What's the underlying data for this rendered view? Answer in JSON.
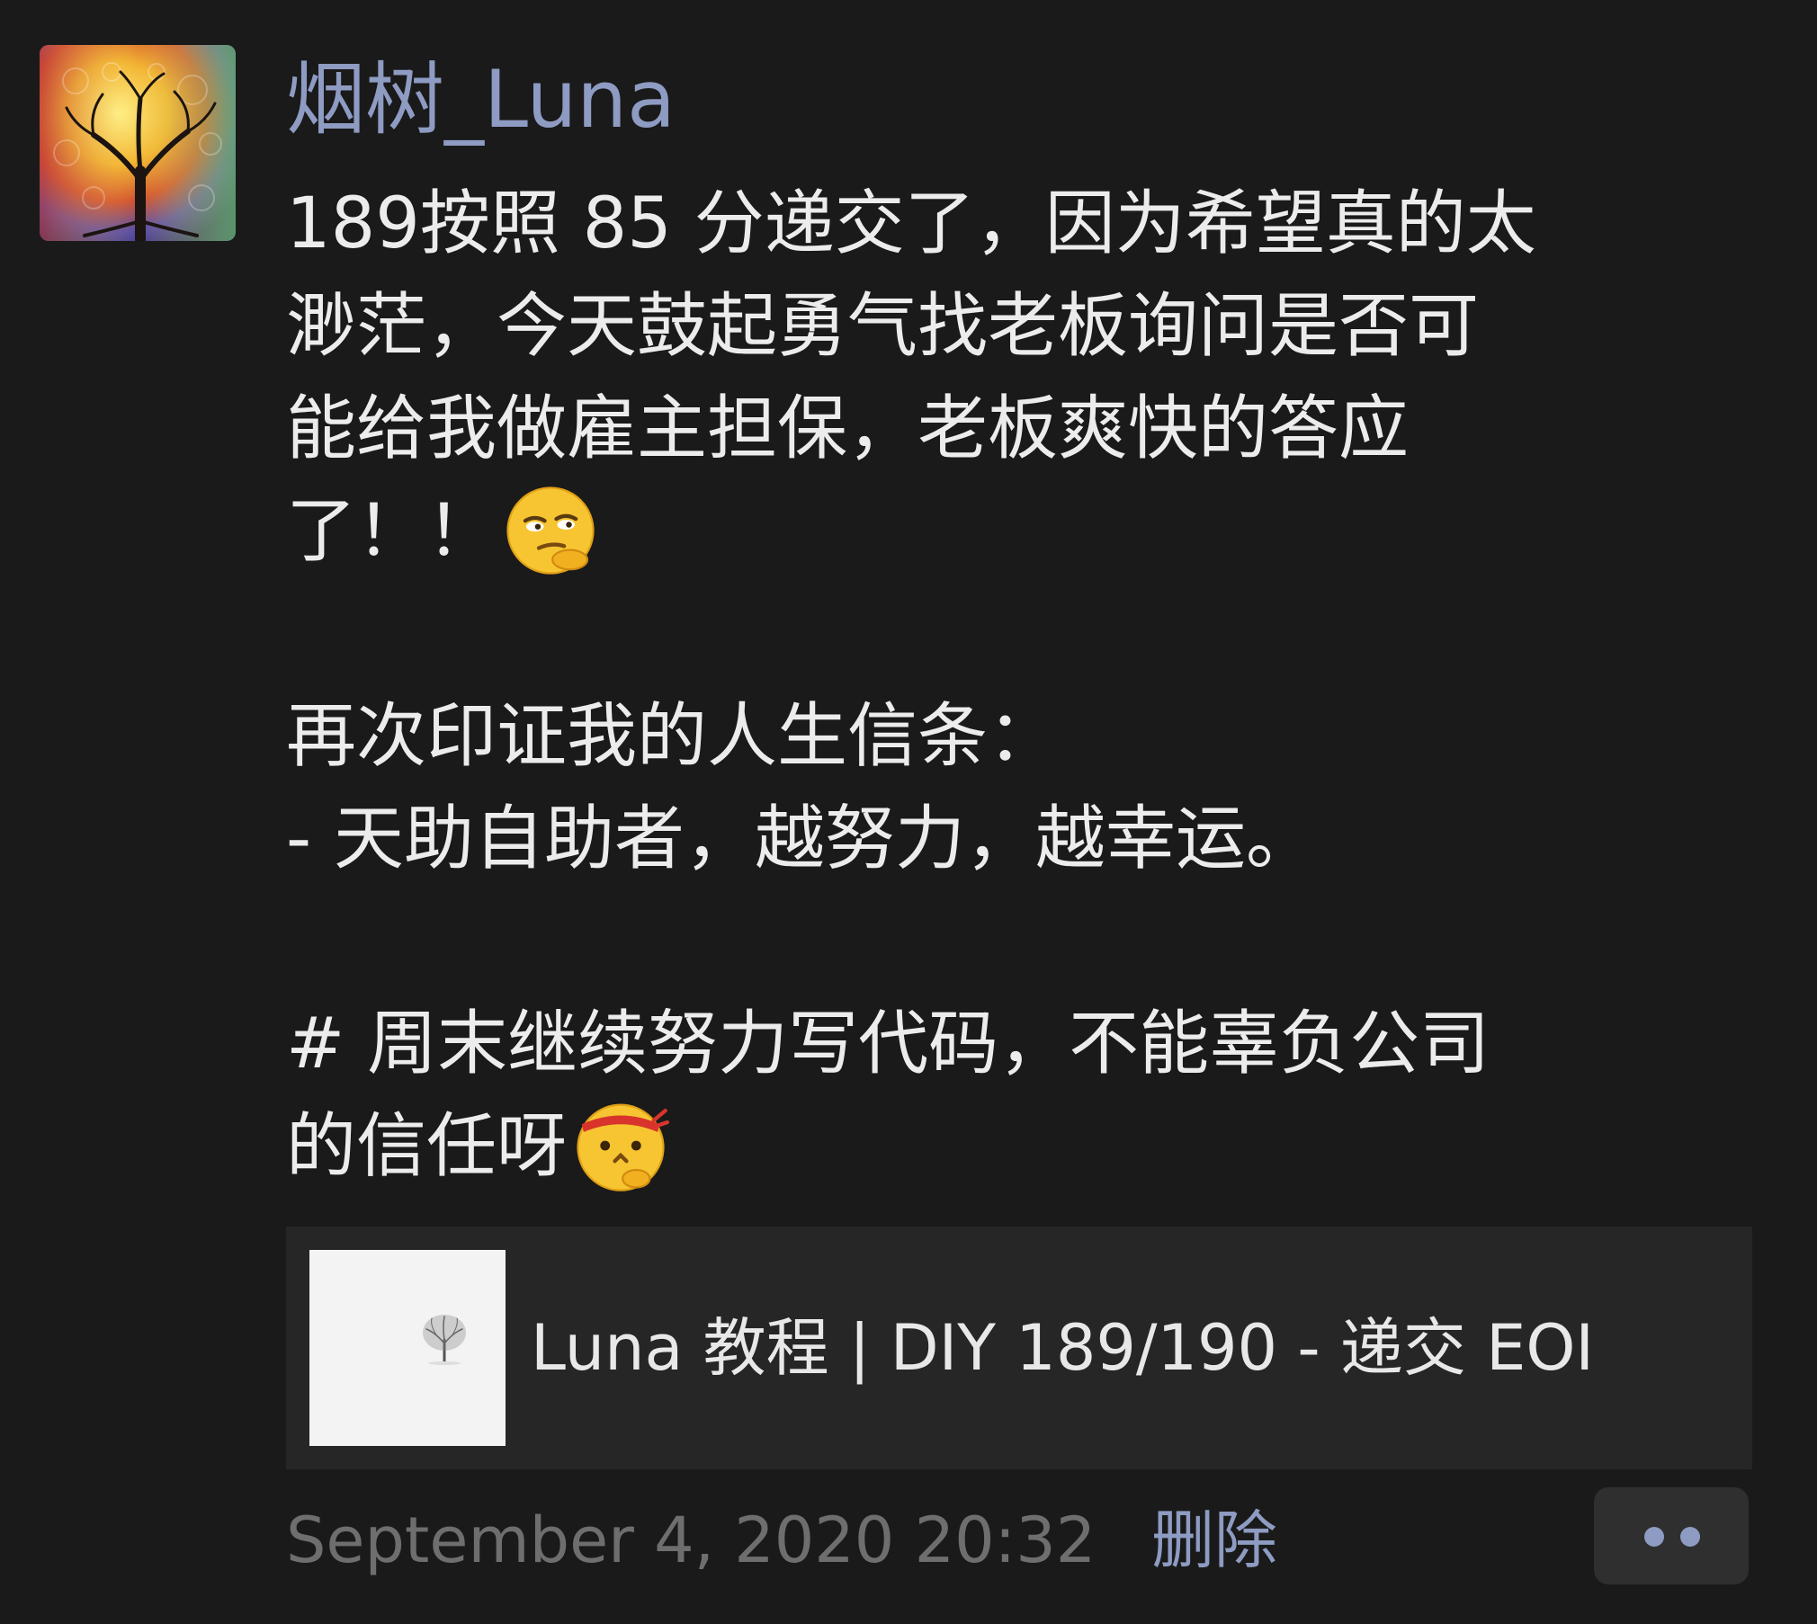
{
  "post": {
    "username": "烟树_Luna",
    "text_lines": [
      "189按照 85 分递交了，因为希望真的太",
      "渺茫，今天鼓起勇气找老板询问是否可",
      "能给我做雇主担保，老板爽快的答应",
      "了！！",
      "",
      "再次印证我的人生信条：",
      "- 天助自助者，越努力，越幸运。",
      "",
      "# 周末继续努力写代码，不能辜负公司",
      "的信任呀"
    ],
    "emojis": [
      "smirk-pointing-emoji",
      "determined-headband-emoji"
    ],
    "link_card": {
      "title": "Luna 教程 | DIY 189/190 - 递交 EOI"
    },
    "timestamp": "September 4, 2020 20:32",
    "delete_label": "删除"
  },
  "colors": {
    "background": "#1a1a1a",
    "username": "#8e9bc2",
    "text": "#ececec",
    "card": "#262626",
    "muted": "#6e6e6e"
  }
}
